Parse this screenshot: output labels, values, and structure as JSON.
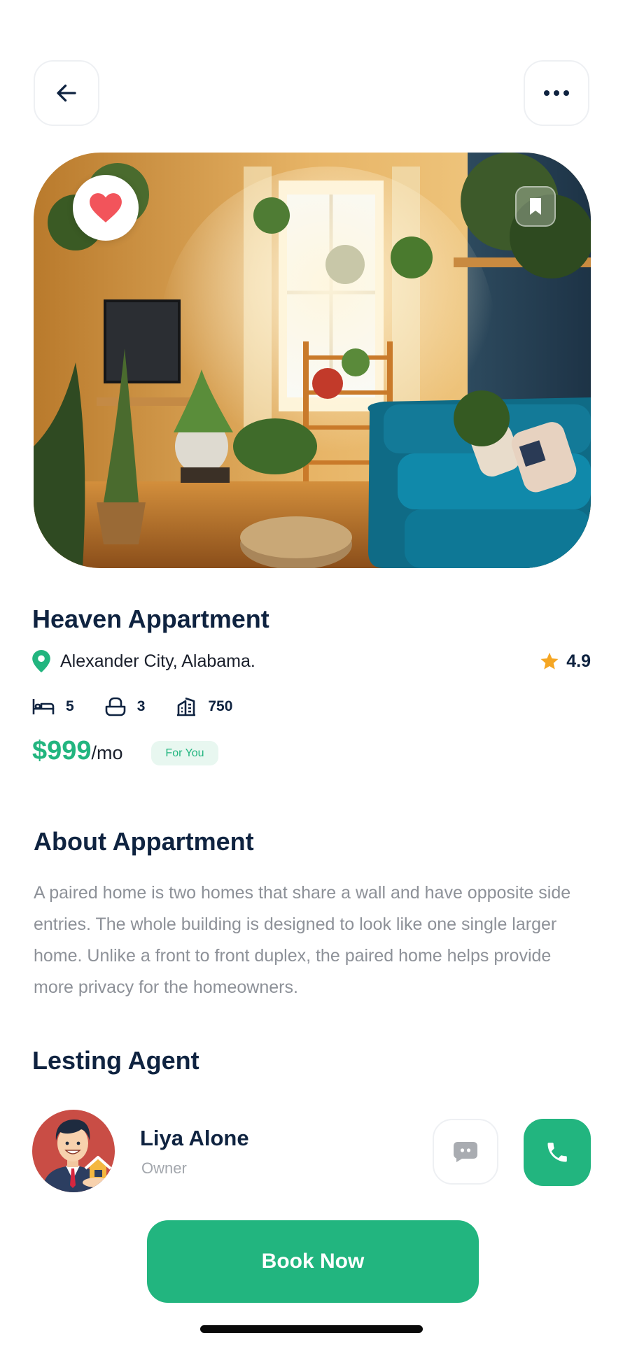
{
  "header": {
    "back_icon": "arrow-left-icon",
    "more_icon": "more-horizontal-icon"
  },
  "hero": {
    "image": "plant-filled living room with blue sofa",
    "favorite_icon": "heart-icon",
    "bookmark_icon": "bookmark-icon"
  },
  "listing": {
    "title": "Heaven Appartment",
    "location": "Alexander City, Alabama.",
    "rating": "4.9",
    "features": [
      {
        "icon": "bed-icon",
        "value": "5"
      },
      {
        "icon": "bathtub-icon",
        "value": "3"
      },
      {
        "icon": "building-area-icon",
        "value": "750"
      }
    ],
    "price": "$999",
    "period": "/mo",
    "tag": "For You"
  },
  "about": {
    "heading": "About Appartment",
    "text": "A paired home is two homes that share a wall and have opposite side entries. The whole building is designed to look like one single larger home. Unlike a front to front duplex, the paired home helps provide more privacy for the homeowners."
  },
  "agent": {
    "heading": "Lesting Agent",
    "name": "Liya Alone",
    "role": "Owner",
    "chat_icon": "chat-icon",
    "call_icon": "phone-icon"
  },
  "cta": {
    "label": "Book Now"
  },
  "colors": {
    "accent": "#22B57F",
    "heading": "#0F2340",
    "muted": "#8D9198",
    "favorite": "#F2545B",
    "star": "#F5A623"
  }
}
